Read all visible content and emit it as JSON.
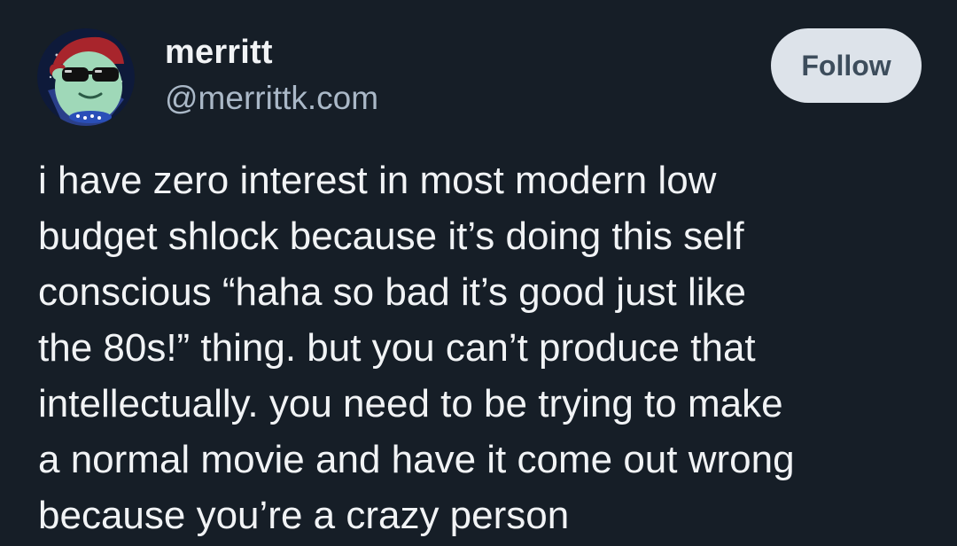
{
  "author": {
    "name": "merritt",
    "handle": "@merrittk.com"
  },
  "follow_button": {
    "label": "Follow"
  },
  "post": {
    "lines": [
      "i have zero interest in most modern low",
      "budget shlock because it’s doing this self",
      "conscious “haha so bad it’s good just like",
      "the 80s!” thing. but you can’t produce that",
      "intellectually. you need to be trying to make",
      "a normal movie and have it come out wrong",
      "because you’re a crazy person"
    ]
  },
  "colors": {
    "background": "#161e27",
    "text": "#f1f3f5",
    "handle": "#aab8c7",
    "button_bg": "#dde3ea",
    "button_text": "#3d4d5c"
  },
  "icons": {
    "avatar": "cartoon-mascot-with-sunglasses-avatar"
  }
}
